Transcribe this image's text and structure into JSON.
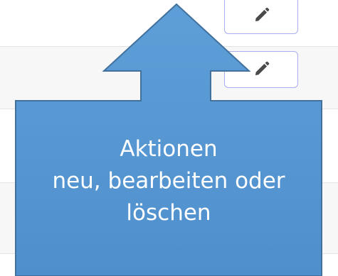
{
  "callout": {
    "line1": "Aktionen",
    "line2": "neu, bearbeiten oder",
    "line3": "löschen"
  },
  "icons": {
    "edit": "pencil-icon"
  },
  "colors": {
    "callout_fill": "#5b9bd5",
    "callout_border": "#41719c",
    "button_border": "#a9aef0",
    "icon": "#4a4a4a"
  }
}
